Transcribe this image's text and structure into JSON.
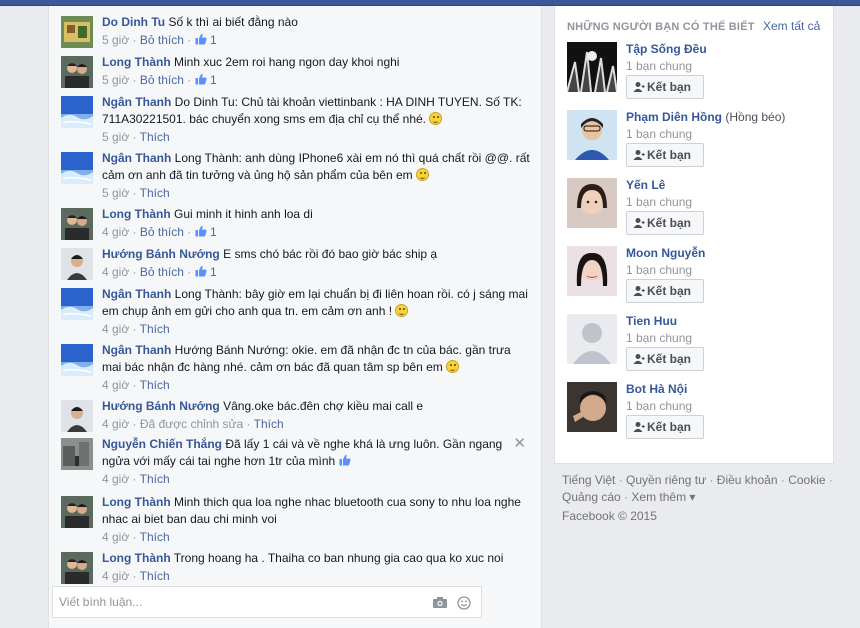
{
  "comments": [
    {
      "name": "Do Dinh Tu",
      "text": "Số k thì ai biết đằng nào",
      "time": "5 giờ",
      "action": "Bỏ thích",
      "likes": "1",
      "emoji": false,
      "avatar": "scene-icon"
    },
    {
      "name": "Long Thành",
      "text": "Minh xuc 2em roi hang ngon day khoi nghi",
      "time": "5 giờ",
      "action": "Bỏ thích",
      "likes": "1",
      "emoji": false,
      "avatar": "couple-icon"
    },
    {
      "name": "Ngân Thanh",
      "text": "Do Dinh Tu: Chủ tài khoản viettinbank : HA DINH TUYEN. Số TK: 711A30221501. bác chuyển xong sms em địa chỉ cụ thể nhé.",
      "time": "5 giờ",
      "action": "Thích",
      "likes": "",
      "emoji": true,
      "avatar": "sky-icon"
    },
    {
      "name": "Ngân Thanh",
      "text": "Long Thành: anh dùng IPhone6 xài em nó thì quá chất rồi @@. rất cảm ơn anh đã tin tưởng và ủng hộ sản phẩm của bên em",
      "time": "5 giờ",
      "action": "Thích",
      "likes": "",
      "emoji": true,
      "avatar": "sky-icon"
    },
    {
      "name": "Long Thành",
      "text": "Gui minh it hinh anh loa di",
      "time": "4 giờ",
      "action": "Bỏ thích",
      "likes": "1",
      "emoji": false,
      "avatar": "couple-icon"
    },
    {
      "name": "Hướng Bánh Nướng",
      "text": "E sms chó bác rồi đó bao giờ bác ship ạ",
      "time": "4 giờ",
      "action": "Bỏ thích",
      "likes": "1",
      "emoji": false,
      "avatar": "person-icon"
    },
    {
      "name": "Ngân Thanh",
      "text": "Long Thành: bây giờ em lại chuẩn bị đi liên hoan rồi. có j sáng mai em chụp ảnh em gửi cho anh qua tn. em cảm ơn anh !",
      "time": "4 giờ",
      "action": "Thích",
      "likes": "",
      "emoji": true,
      "avatar": "sky-icon"
    },
    {
      "name": "Ngân Thanh",
      "text": "Hướng Bánh Nướng: okie. em đã nhận đc tn của bác. gần trưa mai bác nhận đc hàng nhé. cảm ơn bác đã quan tâm sp bên em",
      "time": "4 giờ",
      "action": "Thích",
      "likes": "",
      "emoji": true,
      "avatar": "sky-icon"
    },
    {
      "name": "Hướng Bánh Nướng",
      "text": "Vâng.oke bác.đên chợ kiều mai call e",
      "time": "4 giờ",
      "action": "Thích",
      "likes": "",
      "emoji": false,
      "edited": "Đã được chỉnh sửa",
      "avatar": "person-icon"
    },
    {
      "name": "Nguyễn Chiến Thắng",
      "text": "Đã lấy 1 cái và về nghe khá là ưng luôn. Gần ngang ngửa với mấy cái tai nghe hơn 1tr của mình",
      "time": "4 giờ",
      "action": "Thích",
      "likes": "",
      "emoji": false,
      "thumb_emoji": true,
      "avatar": "street-icon"
    },
    {
      "name": "Long Thành",
      "text": "Minh thich qua loa nghe nhac bluetooth cua sony to nhu loa nghe nhac ai biet ban dau chi minh voi",
      "time": "4 giờ",
      "action": "Thích",
      "likes": "",
      "emoji": false,
      "avatar": "couple-icon"
    },
    {
      "name": "Long Thành",
      "text": "Trong hoang ha . Thaiha co ban nhung gia cao qua ko xuc noi",
      "time": "4 giờ",
      "action": "Thích",
      "likes": "",
      "emoji": false,
      "avatar": "couple-icon"
    }
  ],
  "composer": {
    "placeholder": "Viết bình luận..."
  },
  "suggestions": {
    "title": "NHỮNG NGƯỜI BẠN CÓ THỂ BIẾT",
    "see_all": "Xem tất cả",
    "people": [
      {
        "name": "Tập Sống Đều",
        "alt": "",
        "mutual": "1 bạn chung",
        "button": "Kết bạn"
      },
      {
        "name": "Phạm Diên Hồng",
        "alt": "(Hồng béo)",
        "mutual": "1 bạn chung",
        "button": "Kết bạn"
      },
      {
        "name": "Yến Lê",
        "alt": "",
        "mutual": "1 bạn chung",
        "button": "Kết bạn"
      },
      {
        "name": "Moon Nguyễn",
        "alt": "",
        "mutual": "1 bạn chung",
        "button": "Kết bạn"
      },
      {
        "name": "Tien Huu",
        "alt": "",
        "mutual": "1 bạn chung",
        "button": "Kết bạn"
      },
      {
        "name": "Bot Hà Nội",
        "alt": "",
        "mutual": "1 bạn chung",
        "button": "Kết bạn"
      }
    ]
  },
  "footer": {
    "links": [
      "Tiếng Việt",
      "Quyền riêng tư",
      "Điều khoản",
      "Cookie",
      "Quảng cáo",
      "Xem thêm ▾"
    ],
    "copyright": "Facebook © 2015"
  },
  "colors": {
    "brand": "#3b5998",
    "link": "#365899",
    "meta": "#90949c"
  }
}
